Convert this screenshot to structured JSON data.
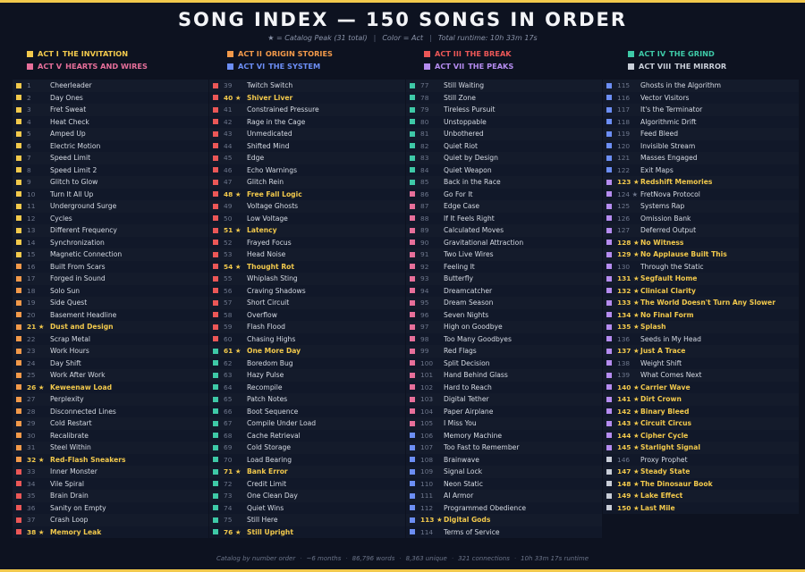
{
  "title": "SONG INDEX — 150 SONGS IN ORDER",
  "subtitle": {
    "peak_note": "★ = Catalog Peak (31 total)",
    "color_note": "Color = Act",
    "runtime": "Total runtime: 10h 33m 17s"
  },
  "acts": [
    {
      "num": "ACT I",
      "name": "THE INVITATION",
      "color": "#f2c94c"
    },
    {
      "num": "ACT II",
      "name": "ORIGIN STORIES",
      "color": "#f2994a"
    },
    {
      "num": "ACT III",
      "name": "THE BREAK",
      "color": "#eb5757"
    },
    {
      "num": "ACT IV",
      "name": "THE GRIND",
      "color": "#3ec9a7"
    },
    {
      "num": "ACT V",
      "name": "HEARTS AND WIRES",
      "color": "#e76f9a"
    },
    {
      "num": "ACT VI",
      "name": "THE SYSTEM",
      "color": "#6c8ef5"
    },
    {
      "num": "ACT VII",
      "name": "THE PEAKS",
      "color": "#b58cf0"
    },
    {
      "num": "ACT VIII",
      "name": "THE MIRROR",
      "color": "#c9ced8"
    }
  ],
  "songs": [
    {
      "n": "1",
      "t": "Cheerleader",
      "a": 0,
      "p": false
    },
    {
      "n": "2",
      "t": "Day Ones",
      "a": 0,
      "p": false
    },
    {
      "n": "3",
      "t": "Fret Sweat",
      "a": 0,
      "p": false
    },
    {
      "n": "4",
      "t": "Heat Check",
      "a": 0,
      "p": false
    },
    {
      "n": "5",
      "t": "Amped Up",
      "a": 0,
      "p": false
    },
    {
      "n": "6",
      "t": "Electric Motion",
      "a": 0,
      "p": false
    },
    {
      "n": "7",
      "t": "Speed Limit",
      "a": 0,
      "p": false
    },
    {
      "n": "8",
      "t": "Speed Limit 2",
      "a": 0,
      "p": false
    },
    {
      "n": "9",
      "t": "Glitch to Glow",
      "a": 0,
      "p": false
    },
    {
      "n": "10",
      "t": "Turn It All Up",
      "a": 0,
      "p": false
    },
    {
      "n": "11",
      "t": "Underground Surge",
      "a": 0,
      "p": false
    },
    {
      "n": "12",
      "t": "Cycles",
      "a": 0,
      "p": false
    },
    {
      "n": "13",
      "t": "Different Frequency",
      "a": 0,
      "p": false
    },
    {
      "n": "14",
      "t": "Synchronization",
      "a": 0,
      "p": false
    },
    {
      "n": "15",
      "t": "Magnetic Connection",
      "a": 0,
      "p": false
    },
    {
      "n": "16",
      "t": "Built From Scars",
      "a": 1,
      "p": false
    },
    {
      "n": "17",
      "t": "Forged in Sound",
      "a": 1,
      "p": false
    },
    {
      "n": "18",
      "t": "Solo Sun",
      "a": 1,
      "p": false
    },
    {
      "n": "19",
      "t": "Side Quest",
      "a": 1,
      "p": false
    },
    {
      "n": "20",
      "t": "Basement Headline",
      "a": 1,
      "p": false
    },
    {
      "n": "21 ★",
      "t": "Dust and Design",
      "a": 1,
      "p": true
    },
    {
      "n": "22",
      "t": "Scrap Metal",
      "a": 1,
      "p": false
    },
    {
      "n": "23",
      "t": "Work Hours",
      "a": 1,
      "p": false
    },
    {
      "n": "24",
      "t": "Day Shift",
      "a": 1,
      "p": false
    },
    {
      "n": "25",
      "t": "Work After Work",
      "a": 1,
      "p": false
    },
    {
      "n": "26 ★",
      "t": "Keweenaw Load",
      "a": 1,
      "p": true
    },
    {
      "n": "27",
      "t": "Perplexity",
      "a": 1,
      "p": false
    },
    {
      "n": "28",
      "t": "Disconnected Lines",
      "a": 1,
      "p": false
    },
    {
      "n": "29",
      "t": "Cold Restart",
      "a": 1,
      "p": false
    },
    {
      "n": "30",
      "t": "Recalibrate",
      "a": 1,
      "p": false
    },
    {
      "n": "31",
      "t": "Steel Within",
      "a": 1,
      "p": false
    },
    {
      "n": "32 ★",
      "t": "Red-Flash Sneakers",
      "a": 1,
      "p": true
    },
    {
      "n": "33",
      "t": "Inner Monster",
      "a": 2,
      "p": false
    },
    {
      "n": "34",
      "t": "Vile Spiral",
      "a": 2,
      "p": false
    },
    {
      "n": "35",
      "t": "Brain Drain",
      "a": 2,
      "p": false
    },
    {
      "n": "36",
      "t": "Sanity on Empty",
      "a": 2,
      "p": false
    },
    {
      "n": "37",
      "t": "Crash Loop",
      "a": 2,
      "p": false
    },
    {
      "n": "38 ★",
      "t": "Memory Leak",
      "a": 2,
      "p": true
    },
    {
      "n": "39",
      "t": "Twitch Switch",
      "a": 2,
      "p": false
    },
    {
      "n": "40 ★",
      "t": "Shiver Liver",
      "a": 2,
      "p": true
    },
    {
      "n": "41",
      "t": "Constrained Pressure",
      "a": 2,
      "p": false
    },
    {
      "n": "42",
      "t": "Rage in the Cage",
      "a": 2,
      "p": false
    },
    {
      "n": "43",
      "t": "Unmedicated",
      "a": 2,
      "p": false
    },
    {
      "n": "44",
      "t": "Shifted Mind",
      "a": 2,
      "p": false
    },
    {
      "n": "45",
      "t": "Edge",
      "a": 2,
      "p": false
    },
    {
      "n": "46",
      "t": "Echo Warnings",
      "a": 2,
      "p": false
    },
    {
      "n": "47",
      "t": "Glitch Rein",
      "a": 2,
      "p": false
    },
    {
      "n": "48 ★",
      "t": "Free Fall Logic",
      "a": 2,
      "p": true
    },
    {
      "n": "49",
      "t": "Voltage Ghosts",
      "a": 2,
      "p": false
    },
    {
      "n": "50",
      "t": "Low Voltage",
      "a": 2,
      "p": false
    },
    {
      "n": "51 ★",
      "t": "Latency",
      "a": 2,
      "p": true
    },
    {
      "n": "52",
      "t": "Frayed Focus",
      "a": 2,
      "p": false
    },
    {
      "n": "53",
      "t": "Head Noise",
      "a": 2,
      "p": false
    },
    {
      "n": "54 ★",
      "t": "Thought Rot",
      "a": 2,
      "p": true
    },
    {
      "n": "55",
      "t": "Whiplash Sting",
      "a": 2,
      "p": false
    },
    {
      "n": "56",
      "t": "Craving Shadows",
      "a": 2,
      "p": false
    },
    {
      "n": "57",
      "t": "Short Circuit",
      "a": 2,
      "p": false
    },
    {
      "n": "58",
      "t": "Overflow",
      "a": 2,
      "p": false
    },
    {
      "n": "59",
      "t": "Flash Flood",
      "a": 2,
      "p": false
    },
    {
      "n": "60",
      "t": "Chasing Highs",
      "a": 2,
      "p": false
    },
    {
      "n": "61 ★",
      "t": "One More Day",
      "a": 3,
      "p": true
    },
    {
      "n": "62",
      "t": "Boredom Bug",
      "a": 3,
      "p": false
    },
    {
      "n": "63",
      "t": "Hazy Pulse",
      "a": 3,
      "p": false
    },
    {
      "n": "64",
      "t": "Recompile",
      "a": 3,
      "p": false
    },
    {
      "n": "65",
      "t": "Patch Notes",
      "a": 3,
      "p": false
    },
    {
      "n": "66",
      "t": "Boot Sequence",
      "a": 3,
      "p": false
    },
    {
      "n": "67",
      "t": "Compile Under Load",
      "a": 3,
      "p": false
    },
    {
      "n": "68",
      "t": "Cache Retrieval",
      "a": 3,
      "p": false
    },
    {
      "n": "69",
      "t": "Cold Storage",
      "a": 3,
      "p": false
    },
    {
      "n": "70",
      "t": "Load Bearing",
      "a": 3,
      "p": false
    },
    {
      "n": "71 ★",
      "t": "Bank Error",
      "a": 3,
      "p": true
    },
    {
      "n": "72",
      "t": "Credit Limit",
      "a": 3,
      "p": false
    },
    {
      "n": "73",
      "t": "One Clean Day",
      "a": 3,
      "p": false
    },
    {
      "n": "74",
      "t": "Quiet Wins",
      "a": 3,
      "p": false
    },
    {
      "n": "75",
      "t": "Still Here",
      "a": 3,
      "p": false
    },
    {
      "n": "76 ★",
      "t": "Still Upright",
      "a": 3,
      "p": true
    },
    {
      "n": "77",
      "t": "Still Waiting",
      "a": 3,
      "p": false
    },
    {
      "n": "78",
      "t": "Still Zone",
      "a": 3,
      "p": false
    },
    {
      "n": "79",
      "t": "Tireless Pursuit",
      "a": 3,
      "p": false
    },
    {
      "n": "80",
      "t": "Unstoppable",
      "a": 3,
      "p": false
    },
    {
      "n": "81",
      "t": "Unbothered",
      "a": 3,
      "p": false
    },
    {
      "n": "82",
      "t": "Quiet Riot",
      "a": 3,
      "p": false
    },
    {
      "n": "83",
      "t": "Quiet by Design",
      "a": 3,
      "p": false
    },
    {
      "n": "84",
      "t": "Quiet Weapon",
      "a": 3,
      "p": false
    },
    {
      "n": "85",
      "t": "Back in the Race",
      "a": 3,
      "p": false
    },
    {
      "n": "86",
      "t": "Go For It",
      "a": 4,
      "p": false
    },
    {
      "n": "87",
      "t": "Edge Case",
      "a": 4,
      "p": false
    },
    {
      "n": "88",
      "t": "If It Feels Right",
      "a": 4,
      "p": false
    },
    {
      "n": "89",
      "t": "Calculated Moves",
      "a": 4,
      "p": false
    },
    {
      "n": "90",
      "t": "Gravitational Attraction",
      "a": 4,
      "p": false
    },
    {
      "n": "91",
      "t": "Two Live Wires",
      "a": 4,
      "p": false
    },
    {
      "n": "92",
      "t": "Feeling It",
      "a": 4,
      "p": false
    },
    {
      "n": "93",
      "t": "Butterfly",
      "a": 4,
      "p": false
    },
    {
      "n": "94",
      "t": "Dreamcatcher",
      "a": 4,
      "p": false
    },
    {
      "n": "95",
      "t": "Dream Season",
      "a": 4,
      "p": false
    },
    {
      "n": "96",
      "t": "Seven Nights",
      "a": 4,
      "p": false
    },
    {
      "n": "97",
      "t": "High on Goodbye",
      "a": 4,
      "p": false
    },
    {
      "n": "98",
      "t": "Too Many Goodbyes",
      "a": 4,
      "p": false
    },
    {
      "n": "99",
      "t": "Red Flags",
      "a": 4,
      "p": false
    },
    {
      "n": "100",
      "t": "Split Decision",
      "a": 4,
      "p": false
    },
    {
      "n": "101",
      "t": "Hand Behind Glass",
      "a": 4,
      "p": false
    },
    {
      "n": "102",
      "t": "Hard to Reach",
      "a": 4,
      "p": false
    },
    {
      "n": "103",
      "t": "Digital Tether",
      "a": 4,
      "p": false
    },
    {
      "n": "104",
      "t": "Paper Airplane",
      "a": 4,
      "p": false
    },
    {
      "n": "105",
      "t": "I Miss You",
      "a": 4,
      "p": false
    },
    {
      "n": "106",
      "t": "Memory Machine",
      "a": 5,
      "p": false
    },
    {
      "n": "107",
      "t": "Too Fast to Remember",
      "a": 5,
      "p": false
    },
    {
      "n": "108",
      "t": "Brainwave",
      "a": 5,
      "p": false
    },
    {
      "n": "109",
      "t": "Signal Lock",
      "a": 5,
      "p": false
    },
    {
      "n": "110",
      "t": "Neon Static",
      "a": 5,
      "p": false
    },
    {
      "n": "111",
      "t": "AI Armor",
      "a": 5,
      "p": false
    },
    {
      "n": "112",
      "t": "Programmed Obedience",
      "a": 5,
      "p": false
    },
    {
      "n": "113 ★",
      "t": "Digital Gods",
      "a": 5,
      "p": true
    },
    {
      "n": "114",
      "t": "Terms of Service",
      "a": 5,
      "p": false
    },
    {
      "n": "115",
      "t": "Ghosts in the Algorithm",
      "a": 5,
      "p": false
    },
    {
      "n": "116",
      "t": "Vector Visitors",
      "a": 5,
      "p": false
    },
    {
      "n": "117",
      "t": "It's the Terminator",
      "a": 5,
      "p": false
    },
    {
      "n": "118",
      "t": "Algorithmic Drift",
      "a": 5,
      "p": false
    },
    {
      "n": "119",
      "t": "Feed Bleed",
      "a": 5,
      "p": false
    },
    {
      "n": "120",
      "t": "Invisible Stream",
      "a": 5,
      "p": false
    },
    {
      "n": "121",
      "t": "Masses Engaged",
      "a": 5,
      "p": false
    },
    {
      "n": "122",
      "t": "Exit Maps",
      "a": 5,
      "p": false
    },
    {
      "n": "123 ★",
      "t": "Redshift Memories",
      "a": 6,
      "p": true
    },
    {
      "n": "124 ★",
      "t": "FretNova Protocol",
      "a": 6,
      "p": false
    },
    {
      "n": "125",
      "t": "Systems Rap",
      "a": 6,
      "p": false
    },
    {
      "n": "126",
      "t": "Omission Bank",
      "a": 6,
      "p": false
    },
    {
      "n": "127",
      "t": "Deferred Output",
      "a": 6,
      "p": false
    },
    {
      "n": "128 ★",
      "t": "No Witness",
      "a": 6,
      "p": true
    },
    {
      "n": "129 ★",
      "t": "No Applause Built This",
      "a": 6,
      "p": true
    },
    {
      "n": "130",
      "t": "Through the Static",
      "a": 6,
      "p": false
    },
    {
      "n": "131 ★",
      "t": "Segfault Home",
      "a": 6,
      "p": true
    },
    {
      "n": "132 ★",
      "t": "Clinical Clarity",
      "a": 6,
      "p": true
    },
    {
      "n": "133 ★",
      "t": "The World Doesn't Turn Any Slower",
      "a": 6,
      "p": true
    },
    {
      "n": "134 ★",
      "t": "No Final Form",
      "a": 6,
      "p": true
    },
    {
      "n": "135 ★",
      "t": "Splash",
      "a": 6,
      "p": true
    },
    {
      "n": "136",
      "t": "Seeds in My Head",
      "a": 6,
      "p": false
    },
    {
      "n": "137 ★",
      "t": "Just A Trace",
      "a": 6,
      "p": true
    },
    {
      "n": "138",
      "t": "Weight Shift",
      "a": 6,
      "p": false
    },
    {
      "n": "139",
      "t": "What Comes Next",
      "a": 6,
      "p": false
    },
    {
      "n": "140 ★",
      "t": "Carrier Wave",
      "a": 6,
      "p": true
    },
    {
      "n": "141 ★",
      "t": "Dirt Crown",
      "a": 6,
      "p": true
    },
    {
      "n": "142 ★",
      "t": "Binary Bleed",
      "a": 6,
      "p": true
    },
    {
      "n": "143 ★",
      "t": "Circuit Circus",
      "a": 6,
      "p": true
    },
    {
      "n": "144 ★",
      "t": "Cipher Cycle",
      "a": 6,
      "p": true
    },
    {
      "n": "145 ★",
      "t": "Starlight Signal",
      "a": 6,
      "p": true
    },
    {
      "n": "146",
      "t": "Proxy Prophet",
      "a": 7,
      "p": false
    },
    {
      "n": "147 ★",
      "t": "Steady State",
      "a": 7,
      "p": true
    },
    {
      "n": "148 ★",
      "t": "The Dinosaur Book",
      "a": 7,
      "p": true
    },
    {
      "n": "149 ★",
      "t": "Lake Effect",
      "a": 7,
      "p": true
    },
    {
      "n": "150 ★",
      "t": "Last Mile",
      "a": 7,
      "p": true
    }
  ],
  "footer": [
    "Catalog by number order",
    "~6 months",
    "86,796 words",
    "8,363 unique",
    "321 connections",
    "10h 33m 17s runtime"
  ]
}
